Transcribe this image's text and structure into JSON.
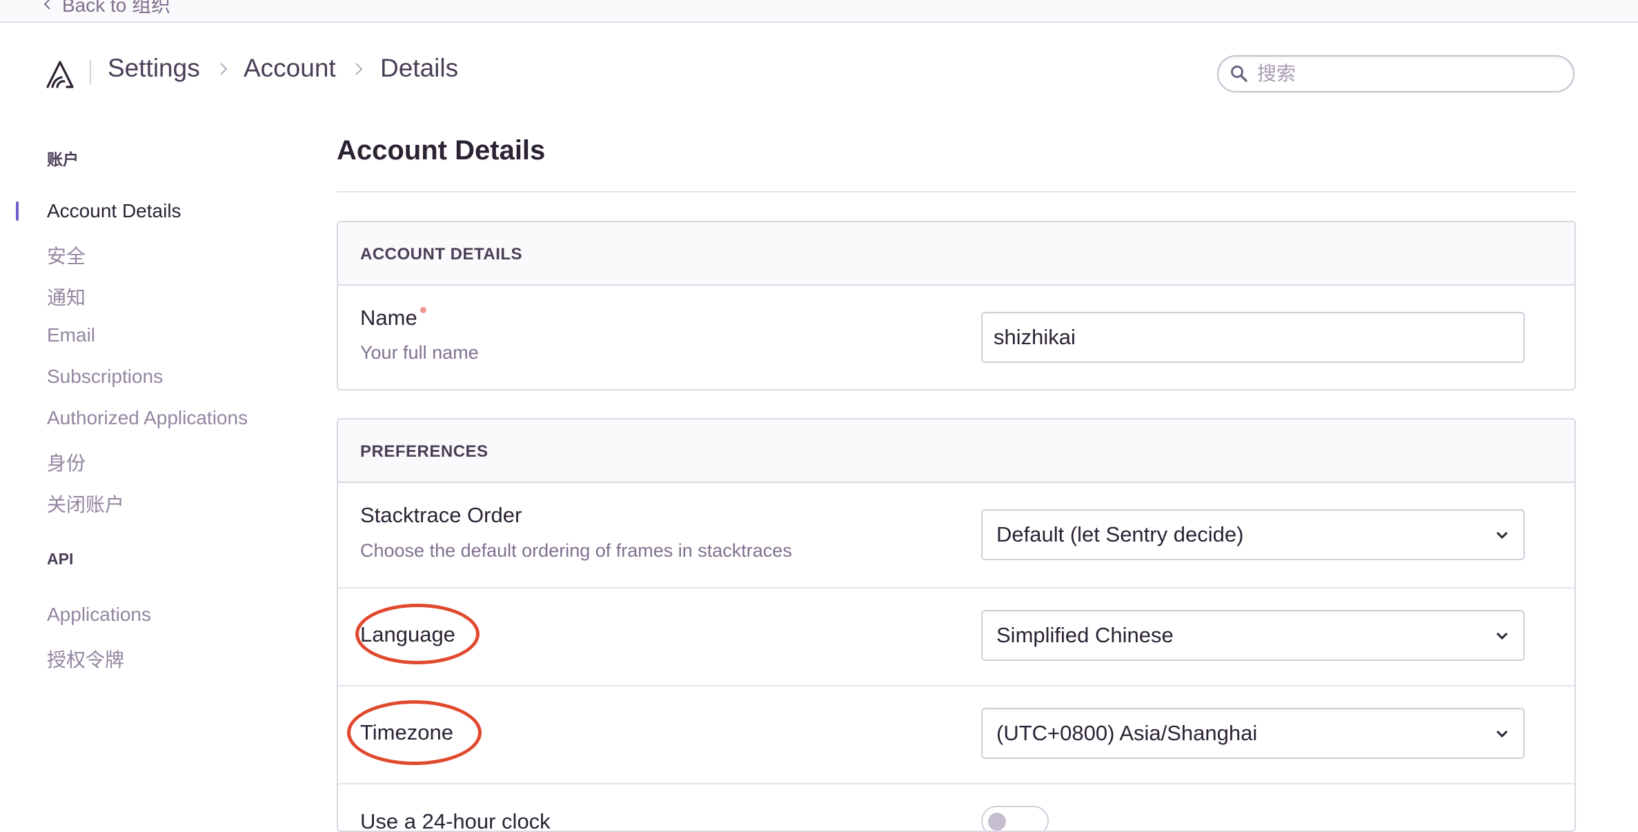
{
  "topbar": {
    "back_label": "Back to 组织"
  },
  "breadcrumbs": [
    "Settings",
    "Account",
    "Details"
  ],
  "search": {
    "placeholder": "搜索",
    "value": ""
  },
  "sidebar": {
    "section_account": "账户",
    "account_items": [
      {
        "label": "Account Details",
        "active": true
      },
      {
        "label": "安全"
      },
      {
        "label": "通知"
      },
      {
        "label": "Email"
      },
      {
        "label": "Subscriptions"
      },
      {
        "label": "Authorized Applications"
      },
      {
        "label": "身份"
      },
      {
        "label": "关闭账户"
      }
    ],
    "section_api": "API",
    "api_items": [
      {
        "label": "Applications"
      },
      {
        "label": "授权令牌"
      }
    ]
  },
  "main": {
    "title": "Account Details",
    "account_panel": {
      "header": "ACCOUNT DETAILS",
      "name_label": "Name",
      "name_help": "Your full name",
      "name_value": "shizhikai"
    },
    "preferences_panel": {
      "header": "PREFERENCES",
      "stacktrace_label": "Stacktrace Order",
      "stacktrace_help": "Choose the default ordering of frames in stacktraces",
      "stacktrace_value": "Default (let Sentry decide)",
      "language_label": "Language",
      "language_value": "Simplified Chinese",
      "timezone_label": "Timezone",
      "timezone_value": "(UTC+0800) Asia/Shanghai",
      "clock_label": "Use a 24-hour clock",
      "clock_enabled": false
    }
  },
  "colors": {
    "accent": "#6c5fc7",
    "annotation": "#e0492d",
    "required": "#f0958e"
  },
  "icons": [
    "chevron-left-icon",
    "sentry-logo-icon",
    "chevron-right-icon",
    "search-icon",
    "chevron-down-icon"
  ]
}
